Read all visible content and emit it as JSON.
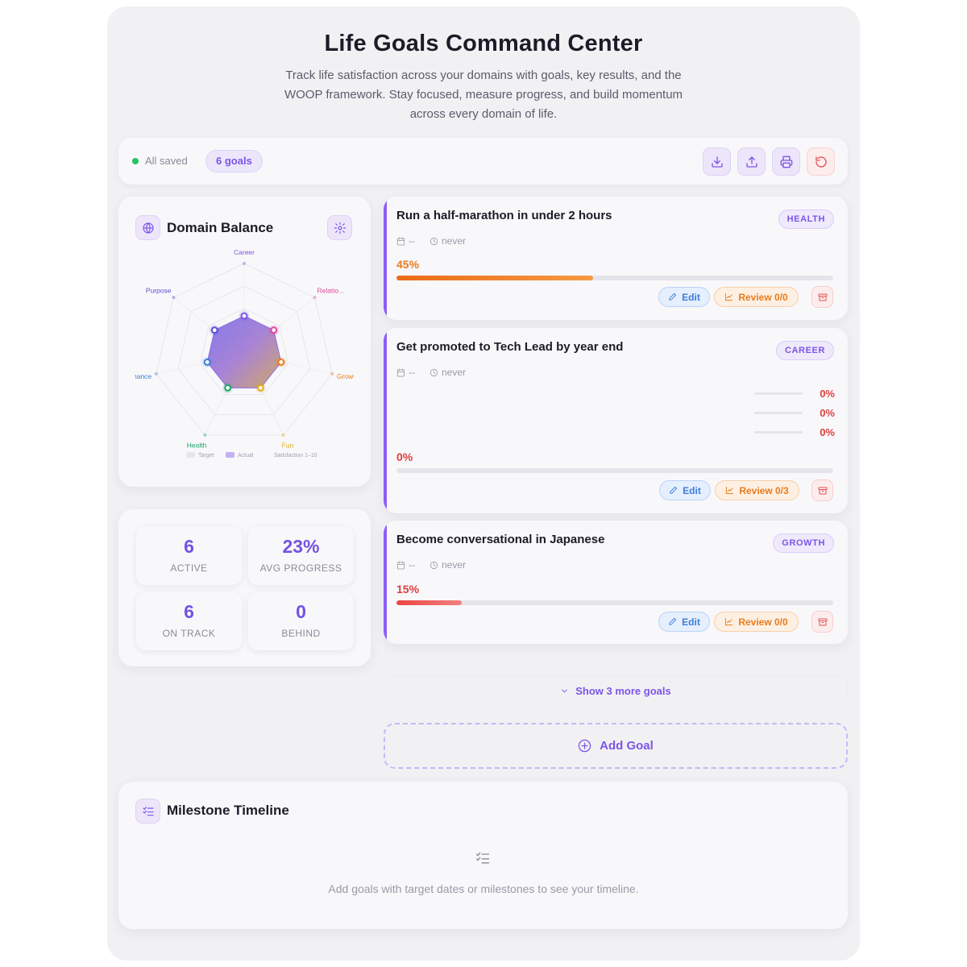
{
  "header": {
    "title": "Life Goals Command Center",
    "subtitle": "Track life satisfaction across your domains with goals, key results, and the WOOP framework. Stay focused, measure progress, and build momentum across every domain of life."
  },
  "toolbar": {
    "saved_status": "All saved",
    "goal_count": "6 goals",
    "buttons": [
      {
        "icon": "download-icon"
      },
      {
        "icon": "upload-icon"
      },
      {
        "icon": "print-icon"
      },
      {
        "icon": "reset-icon"
      }
    ]
  },
  "domain_balance": {
    "title": "Domain Balance",
    "scale_note": "Satisfaction 1–10",
    "legend": [
      "Target",
      "Actual"
    ],
    "domains": [
      {
        "name": "Career",
        "color": "#7c55e6"
      },
      {
        "name": "Relatio...",
        "color": "#e0459a"
      },
      {
        "name": "Growth",
        "color": "#ea7b1c"
      },
      {
        "name": "Fun",
        "color": "#e3a91a"
      },
      {
        "name": "Health",
        "color": "#1aa56a"
      },
      {
        "name": "Finance",
        "color": "#3b7ddd"
      },
      {
        "name": "Purpose",
        "color": "#5b4fd6"
      }
    ]
  },
  "stats": [
    {
      "value": "6",
      "label": "ACTIVE"
    },
    {
      "value": "23%",
      "label": "AVG PROGRESS"
    },
    {
      "value": "6",
      "label": "ON TRACK"
    },
    {
      "value": "0",
      "label": "BEHIND"
    }
  ],
  "goals": [
    {
      "title": "Run a half-marathon in under 2 hours",
      "tag": "HEALTH",
      "date": "--",
      "last": "never",
      "progress_label": "45%",
      "progress": 0.45,
      "color": "#ea7b1c",
      "key_results": [],
      "edit": "Edit",
      "review": "Review 0/0"
    },
    {
      "title": "Get promoted to Tech Lead by year end",
      "tag": "CAREER",
      "date": "--",
      "last": "never",
      "progress_label": "0%",
      "progress": 0,
      "color": "#e03e3e",
      "key_results": [
        "0%",
        "0%",
        "0%"
      ],
      "edit": "Edit",
      "review": "Review 0/3"
    },
    {
      "title": "Become conversational in Japanese",
      "tag": "GROWTH",
      "date": "--",
      "last": "never",
      "progress_label": "15%",
      "progress": 0.15,
      "color": "#e03e3e",
      "key_results": [],
      "edit": "Edit",
      "review": "Review 0/0"
    }
  ],
  "show_more": "Show 3 more goals",
  "add_goal": "Add Goal",
  "timeline": {
    "title": "Milestone Timeline",
    "empty_text": "Add goals with target dates or milestones to see your timeline."
  }
}
